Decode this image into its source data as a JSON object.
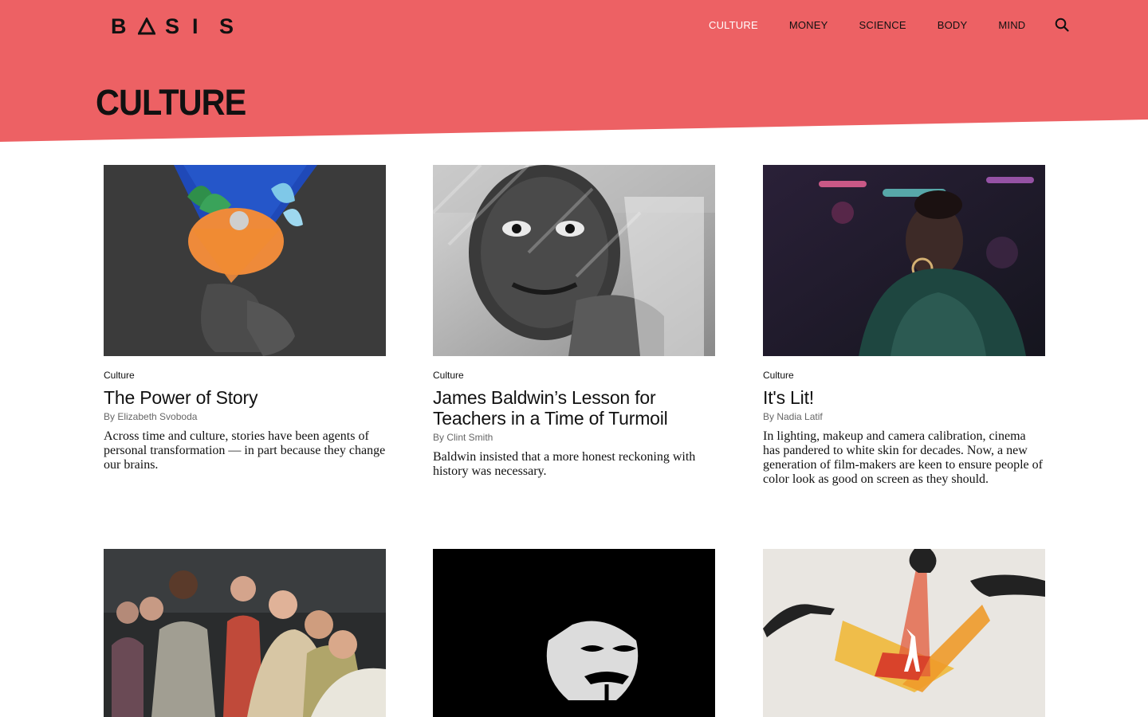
{
  "brand": {
    "logo_letters": [
      "B",
      "",
      "S",
      "I",
      "S"
    ],
    "accent": "#ed6164"
  },
  "nav": {
    "items": [
      {
        "label": "CULTURE",
        "active": true
      },
      {
        "label": "MONEY",
        "active": false
      },
      {
        "label": "SCIENCE",
        "active": false
      },
      {
        "label": "BODY",
        "active": false
      },
      {
        "label": "MIND",
        "active": false
      }
    ],
    "search_icon": "search-icon"
  },
  "page": {
    "title": "CULTURE"
  },
  "articles": [
    {
      "category": "Culture",
      "title": "The Power of Story",
      "byline": "By Elizabeth Svoboda",
      "excerpt": "Across time and culture, stories have been agents of personal transformation — in part because they change our brains."
    },
    {
      "category": "Culture",
      "title": "James Baldwin’s Lesson for Teachers in a Time of Turmoil",
      "byline": "By Clint Smith",
      "excerpt": "Baldwin insisted that a more honest reckoning with history was necessary."
    },
    {
      "category": "Culture",
      "title": "It's Lit!",
      "byline": "By Nadia Latif",
      "excerpt": "In lighting, makeup and camera calibration, cinema has pandered to white skin for decades. Now, a new generation of film-makers are keen to ensure people of color look as good on screen as they should."
    },
    {
      "category": "",
      "title": "",
      "byline": "",
      "excerpt": ""
    },
    {
      "category": "",
      "title": "",
      "byline": "",
      "excerpt": ""
    },
    {
      "category": "",
      "title": "",
      "byline": "",
      "excerpt": ""
    }
  ]
}
